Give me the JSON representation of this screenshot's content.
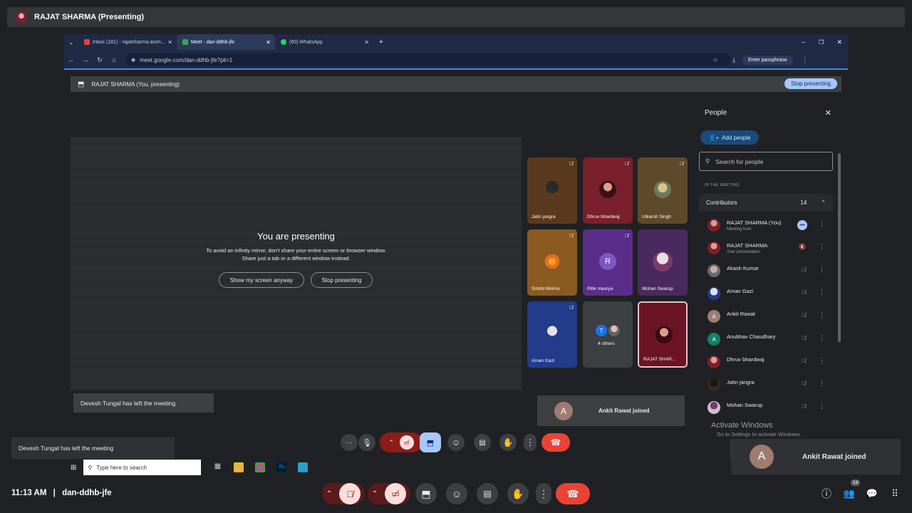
{
  "top_bar": {
    "title": "RAJAT SHARMA (Presenting)"
  },
  "browser": {
    "tabs": [
      {
        "label": "Inbox (181) - rajatsharma.anim...",
        "color": "#ea4335"
      },
      {
        "label": "Meet - dan-ddhb-jfe",
        "color": "#34a853"
      },
      {
        "label": "(60) WhatsApp",
        "color": "#25d366"
      }
    ],
    "new_tab": "+",
    "url": "meet.google.com/dan-ddhb-jfe?pli=1",
    "passphrase": "Enter passphrase"
  },
  "banner": {
    "text": "RAJAT SHARMA (You, presenting)",
    "stop_label": "Stop presenting"
  },
  "stage": {
    "heading": "You are presenting",
    "message_line1": "To avoid an infinity mirror, don't share your entire screen or browser window.",
    "message_line2": "Share just a tab or a different window instead.",
    "show_anyway": "Show my screen anyway",
    "stop": "Stop presenting"
  },
  "tiles": [
    {
      "name": "Jatin jangra",
      "bg": "#5a3a1e"
    },
    {
      "name": "Dhruv bhardwaj",
      "bg": "#7a1f2c"
    },
    {
      "name": "Utkarsh Singh",
      "bg": "#5e4a2a"
    },
    {
      "name": "Srishti Mishra",
      "bg": "#8a5a20"
    },
    {
      "name": "Ritik maurya",
      "bg": "#5a2d8a",
      "initial": "R"
    },
    {
      "name": "Mohan Swarup",
      "bg": "#4a2a5e"
    },
    {
      "name": "Aman Gazi",
      "bg": "#243a8a"
    },
    {
      "name": "4 others",
      "bg": "#3c4043",
      "initial": "T"
    },
    {
      "name": "RAJAT SHAR...",
      "bg": "#6a1424"
    }
  ],
  "people": {
    "title": "People",
    "add_people": "Add people",
    "search_placeholder": "Search for people",
    "section": "IN THE MEETING",
    "contributors_label": "Contributors",
    "contributors_count": "14",
    "list": [
      {
        "name": "RAJAT SHARMA (You)",
        "sub": "Meeting host",
        "color": "#7a1f2c"
      },
      {
        "name": "RAJAT SHARMA",
        "sub": "Your presentation",
        "color": "#7a1f2c"
      },
      {
        "name": "Akash Kumar",
        "sub": "",
        "color": "#6b6b6b"
      },
      {
        "name": "Aman Gazi",
        "sub": "",
        "color": "#243a8a"
      },
      {
        "name": "Ankit Rawat",
        "sub": "",
        "color": "#9e7c72",
        "initial": "A"
      },
      {
        "name": "Anubhav Chaudhary",
        "sub": "",
        "color": "#12806a",
        "initial": "A"
      },
      {
        "name": "Dhruv bhardwaj",
        "sub": "",
        "color": "#7a1f2c"
      },
      {
        "name": "Jatin jangra",
        "sub": "",
        "color": "#3a2a1e"
      },
      {
        "name": "Mohan Swarup",
        "sub": "",
        "color": "#c8c2d0"
      }
    ]
  },
  "toasts": {
    "left_inner": "Devesh Tungal has left the meeting",
    "left_outer": "Devesh Tungal has left the meeting",
    "joined_inner": "Ankit Rawat joined",
    "joined_outer": "Ankit Rawat joined",
    "joined_initial": "A"
  },
  "windows": {
    "activate_title": "Activate Windows",
    "activate_sub": "Go to Settings to activate Windows.",
    "search_placeholder": "Type here to search"
  },
  "bottom": {
    "time": "11:13 AM",
    "separator": "|",
    "meeting_code": "dan-ddhb-jfe",
    "people_badge": "14"
  },
  "colors": {
    "accent": "#a8c7fa",
    "hangup": "#ea4335",
    "muted_red": "#f9dedc"
  }
}
